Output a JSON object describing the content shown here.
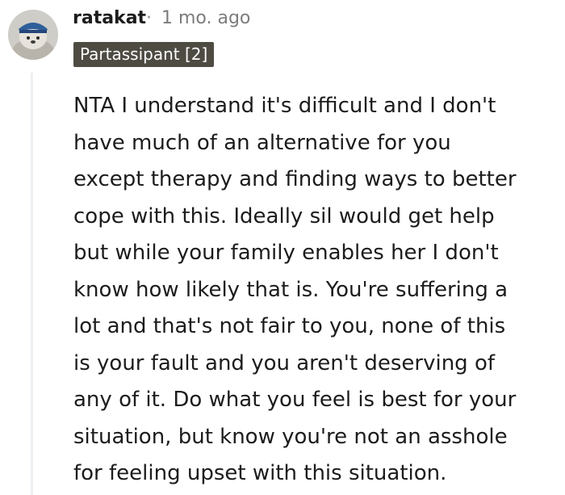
{
  "comment": {
    "author": "ratakat",
    "separator": "·",
    "timestamp": "1 mo. ago",
    "flair": "Partassipant [2]",
    "body_lines": [
      "NTA I understand it's difficult and I don't",
      "have much of an alternative for you",
      "except therapy and finding ways to better",
      "cope with this. Ideally sil would get help",
      "but while your family enables her I don't",
      "know how likely that is. You're suffering a",
      "lot and that's not fair to you, none of this",
      "is your fault and you aren't deserving of",
      "any of it. Do what you feel is best for your",
      "situation, but know you're not an asshole",
      "for feeling upset with this situation."
    ]
  },
  "colors": {
    "flair_background": "#4e4b43",
    "text": "#1c1c1c",
    "meta_text": "#7c7c7c",
    "thread_line": "#edeff1"
  }
}
